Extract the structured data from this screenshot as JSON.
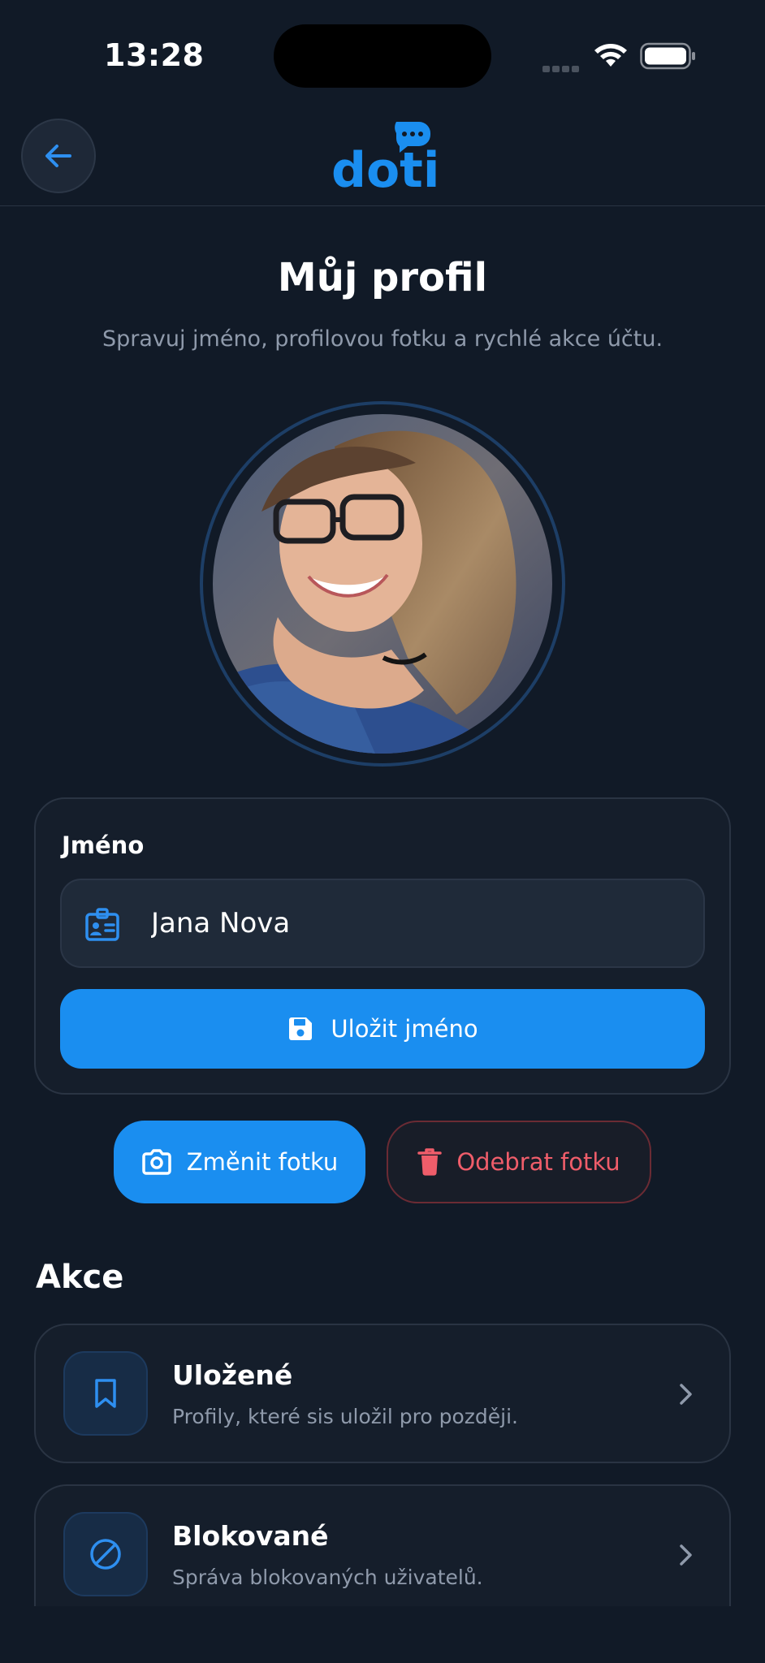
{
  "status_bar": {
    "time": "13:28"
  },
  "header": {
    "logo_text": "doti"
  },
  "page": {
    "title": "Můj profil",
    "subtitle": "Spravuj jméno, profilovou fotku a rychlé akce účtu."
  },
  "name_card": {
    "label": "Jméno",
    "value": "Jana Nova",
    "save_label": "Uložit jméno"
  },
  "photo_actions": {
    "change_label": "Změnit fotku",
    "remove_label": "Odebrat fotku"
  },
  "actions": {
    "title": "Akce",
    "items": [
      {
        "title": "Uložené",
        "description": "Profily, které sis uložil pro později.",
        "icon": "bookmark-icon"
      },
      {
        "title": "Blokované",
        "description": "Správa blokovaných uživatelů.",
        "icon": "block-icon"
      }
    ]
  },
  "colors": {
    "background": "#111a27",
    "accent": "#1a8ef0",
    "danger": "#ef5d6a",
    "muted_text": "#8f9aab"
  }
}
